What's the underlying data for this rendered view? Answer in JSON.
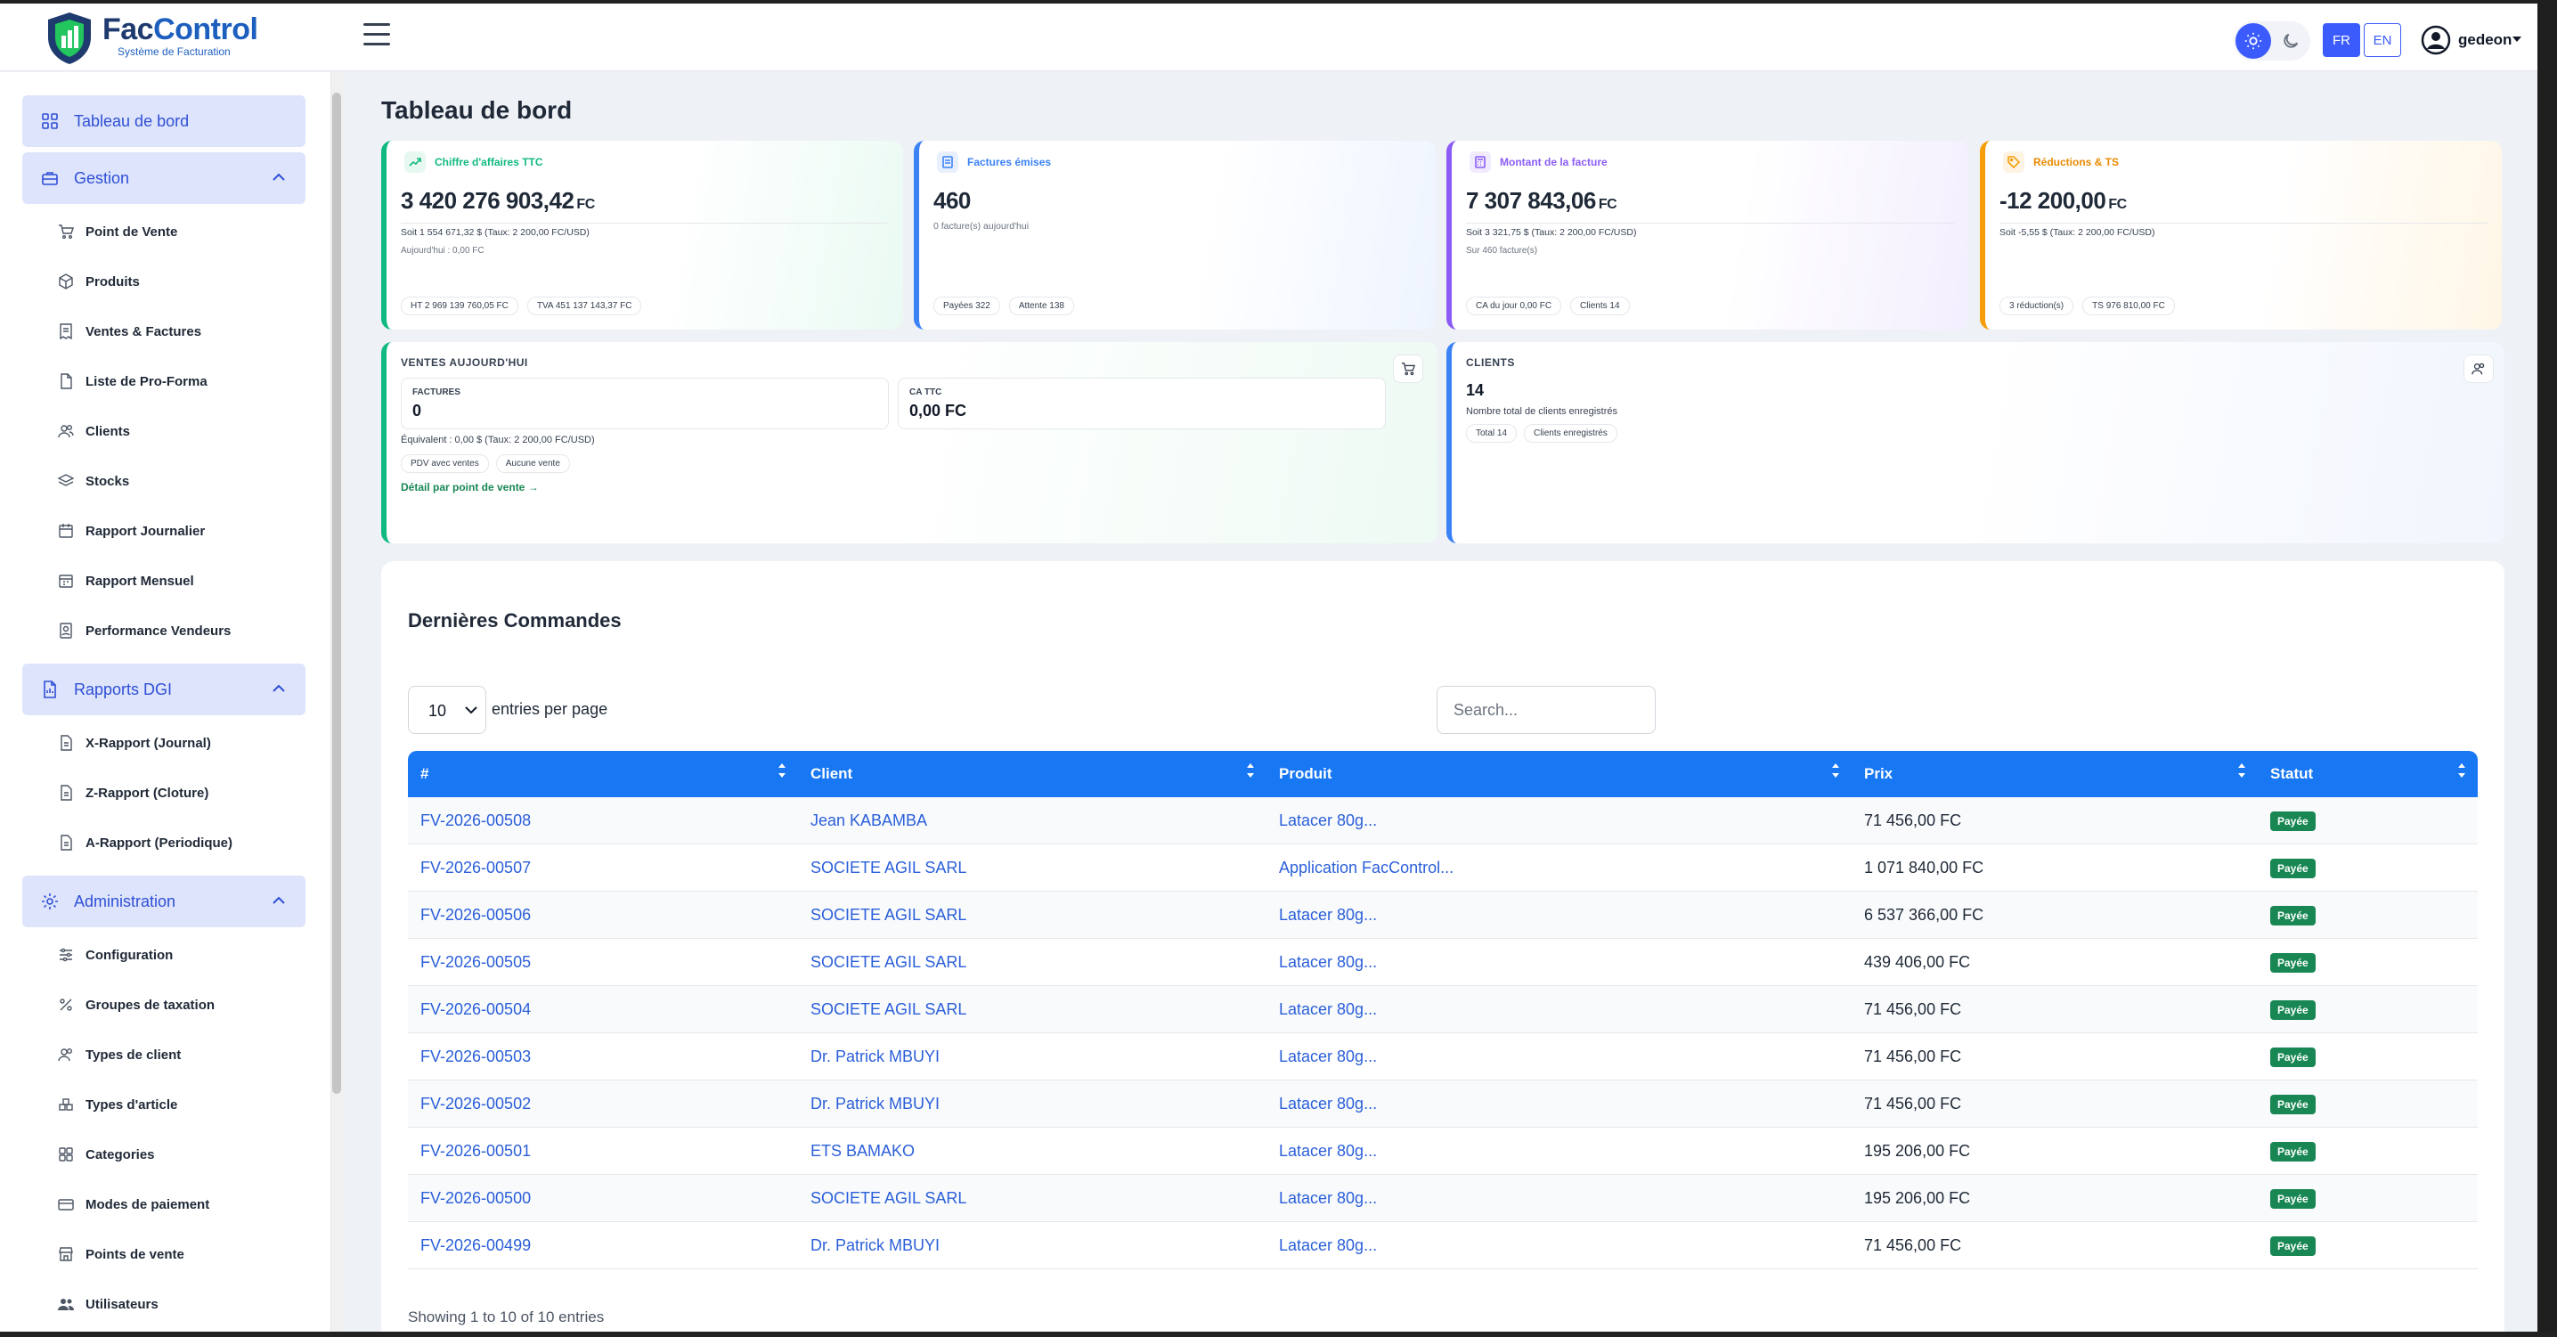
{
  "brand": {
    "name_part1": "Fac",
    "name_part2": "Control",
    "subtitle": "Système de Facturation"
  },
  "navbar": {
    "languages": [
      "FR",
      "EN"
    ],
    "active_language": "FR",
    "theme_active": "light",
    "user_name": "gedeon"
  },
  "sidebar": {
    "dashboard": "Tableau de bord",
    "gestion": {
      "label": "Gestion",
      "items": [
        "Point de Vente",
        "Produits",
        "Ventes & Factures",
        "Liste de Pro-Forma",
        "Clients",
        "Stocks",
        "Rapport Journalier",
        "Rapport Mensuel",
        "Performance Vendeurs"
      ]
    },
    "rapports": {
      "label": "Rapports DGI",
      "items": [
        "X-Rapport (Journal)",
        "Z-Rapport (Cloture)",
        "A-Rapport (Periodique)"
      ]
    },
    "admin": {
      "label": "Administration",
      "items": [
        "Configuration",
        "Groupes de taxation",
        "Types de client",
        "Types d'article",
        "Categories",
        "Modes de paiement",
        "Points de vente",
        "Utilisateurs"
      ]
    }
  },
  "page_title": "Tableau de bord",
  "kpis": {
    "ca": {
      "title": "Chiffre d'affaires TTC",
      "value": "3 420 276 903,42",
      "unit": "FC",
      "line1": "Soit 1 554 671,32 $ (Taux: 2 200,00 FC/USD)",
      "line2": "Aujourd'hui : 0,00 FC",
      "chips": [
        "HT 2 969 139 760,05 FC",
        "TVA 451 137 143,37 FC"
      ]
    },
    "factures": {
      "title": "Factures émises",
      "value": "460",
      "unit": "",
      "line1": "0 facture(s) aujourd'hui",
      "line2": "",
      "chips": [
        "Payées 322",
        "Attente 138"
      ]
    },
    "montant": {
      "title": "Montant de la facture",
      "value": "7 307 843,06",
      "unit": "FC",
      "line1": "Soit 3 321,75 $ (Taux: 2 200,00 FC/USD)",
      "line2": "Sur 460 facture(s)",
      "chips": [
        "CA du jour 0,00 FC",
        "Clients 14"
      ]
    },
    "reductions": {
      "title": "Réductions & TS",
      "value": "-12 200,00",
      "unit": "FC",
      "line1": "Soit -5,55 $ (Taux: 2 200,00 FC/USD)",
      "line2": "",
      "chips": [
        "3 réduction(s)",
        "TS 976 810,00 FC"
      ]
    }
  },
  "ventes_today": {
    "title": "VENTES AUJOURD'HUI",
    "factures_label": "FACTURES",
    "factures_value": "0",
    "ca_label": "CA TTC",
    "ca_value": "0,00 FC",
    "equivalent": "Équivalent : 0,00 $ (Taux: 2 200,00 FC/USD)",
    "chips": [
      "PDV avec ventes",
      "Aucune vente"
    ],
    "detail_link": "Détail par point de vente →"
  },
  "clients_card": {
    "title": "CLIENTS",
    "value": "14",
    "desc": "Nombre total de clients enregistrés",
    "chips": [
      "Total 14",
      "Clients enregistrés"
    ]
  },
  "orders": {
    "title": "Dernières Commandes",
    "per_page": "10",
    "per_page_label": "entries per page",
    "search_placeholder": "Search...",
    "columns": [
      "#",
      "Client",
      "Produit",
      "Prix",
      "Statut"
    ],
    "rows": [
      {
        "id": "FV-2026-00508",
        "client": "Jean KABAMBA",
        "produit": "Latacer 80g...",
        "prix": "71 456,00 FC",
        "statut": "Payée"
      },
      {
        "id": "FV-2026-00507",
        "client": "SOCIETE AGIL SARL",
        "produit": "Application FacControl...",
        "prix": "1 071 840,00 FC",
        "statut": "Payée"
      },
      {
        "id": "FV-2026-00506",
        "client": "SOCIETE AGIL SARL",
        "produit": "Latacer 80g...",
        "prix": "6 537 366,00 FC",
        "statut": "Payée"
      },
      {
        "id": "FV-2026-00505",
        "client": "SOCIETE AGIL SARL",
        "produit": "Latacer 80g...",
        "prix": "439 406,00 FC",
        "statut": "Payée"
      },
      {
        "id": "FV-2026-00504",
        "client": "SOCIETE AGIL SARL",
        "produit": "Latacer 80g...",
        "prix": "71 456,00 FC",
        "statut": "Payée"
      },
      {
        "id": "FV-2026-00503",
        "client": "Dr. Patrick MBUYI",
        "produit": "Latacer 80g...",
        "prix": "71 456,00 FC",
        "statut": "Payée"
      },
      {
        "id": "FV-2026-00502",
        "client": "Dr. Patrick MBUYI",
        "produit": "Latacer 80g...",
        "prix": "71 456,00 FC",
        "statut": "Payée"
      },
      {
        "id": "FV-2026-00501",
        "client": "ETS BAMAKO",
        "produit": "Latacer 80g...",
        "prix": "195 206,00 FC",
        "statut": "Payée"
      },
      {
        "id": "FV-2026-00500",
        "client": "SOCIETE AGIL SARL",
        "produit": "Latacer 80g...",
        "prix": "195 206,00 FC",
        "statut": "Payée"
      },
      {
        "id": "FV-2026-00499",
        "client": "Dr. Patrick MBUYI",
        "produit": "Latacer 80g...",
        "prix": "71 456,00 FC",
        "statut": "Payée"
      }
    ],
    "showing": "Showing 1 to 10 of 10 entries"
  },
  "colors": {
    "primary": "#3b5bfd",
    "table_header": "#1877f2",
    "paid": "#198754",
    "green": "#10b981",
    "blue": "#3b82f6",
    "purple": "#8b5cf6",
    "orange": "#f59e0b"
  }
}
